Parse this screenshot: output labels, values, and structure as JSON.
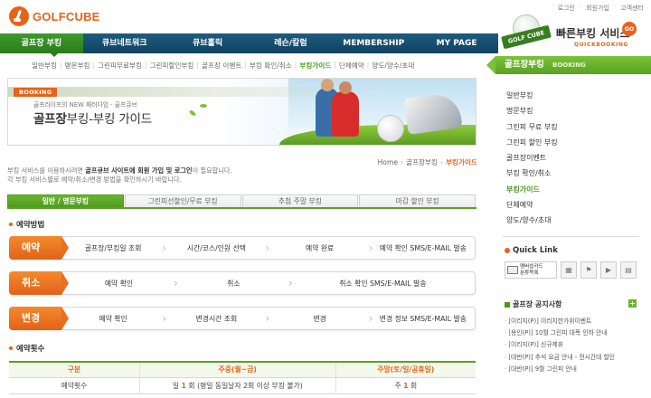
{
  "logo": {
    "text": "GOLFCUBE"
  },
  "util_links": [
    "로그인",
    "회원가입",
    "고객센터"
  ],
  "gnb": [
    {
      "label": "골프장 부킹",
      "active": true
    },
    {
      "label": "큐브네트워크",
      "active": false
    },
    {
      "label": "큐브홀릭",
      "active": false
    },
    {
      "label": "레슨/칼럼",
      "active": false
    },
    {
      "label": "MEMBERSHIP",
      "active": false
    },
    {
      "label": "MY PAGE",
      "active": false
    }
  ],
  "snb": [
    {
      "label": "일반부킹",
      "active": false
    },
    {
      "label": "명문부킹",
      "active": false
    },
    {
      "label": "그린피무료부킹",
      "active": false
    },
    {
      "label": "그린피할인부킹",
      "active": false
    },
    {
      "label": "골프장 이벤트",
      "active": false
    },
    {
      "label": "부킹 확인/취소",
      "active": false
    },
    {
      "label": "부킹가이드",
      "active": true
    },
    {
      "label": "단체예약",
      "active": false
    },
    {
      "label": "양도/양수/초대",
      "active": false
    }
  ],
  "booking_badge": {
    "tag": "GOLF CUBE",
    "title": "빠른부킹 서비스",
    "go": "GO",
    "sub": "QUICKBOOKING"
  },
  "banner": {
    "badge": "BOOKING",
    "small": "골프라이프의 NEW 패러다임 - 골프큐브",
    "title_bold": "골프장",
    "title_rest": "부킹-부킹 가이드"
  },
  "breadcrumb": {
    "home": "Home",
    "mid": "골프장부킹",
    "current": "부킹가이드"
  },
  "intro": {
    "line1_a": "부킹 서비스를 이용하시려면 ",
    "line1_b": "골프큐브 사이트에 회원 가입 및 로그인",
    "line1_c": "이 필요합니다.",
    "line2": "각 부킹 서비스별로 예약/취소/변경 방법을 확인하시기 바랍니다."
  },
  "tabs": [
    {
      "label": "일반 / 명문부킹",
      "active": true
    },
    {
      "label": "그린피선할인/무료 부킹",
      "active": false
    },
    {
      "label": "추첨 주말 부킹",
      "active": false
    },
    {
      "label": "마감 할인 부킹",
      "active": false
    }
  ],
  "section_method": "예약방법",
  "flows": [
    {
      "label": "예약",
      "steps": [
        "골프장/부킹일 조회",
        "시간/코스/인원 선택",
        "예약 완료",
        "예약 확인 SMS/E-MAIL 발송"
      ]
    },
    {
      "label": "취소",
      "steps": [
        "예약 확인",
        "취소",
        "취소 확인 SMS/E-MAIL 발송"
      ]
    },
    {
      "label": "변경",
      "steps": [
        "예약 확인",
        "변경시간 조회",
        "변경",
        "변경 정보 SMS/E-MAIL 발송"
      ]
    }
  ],
  "section_count": "예약횟수",
  "count_table": {
    "headers": [
      "구분",
      "주중(월~금)",
      "주말(토/일/공휴일)"
    ],
    "row": {
      "label": "예약횟수",
      "weekday_pre": "일 ",
      "weekday_num": "1",
      "weekday_post": " 회 (평일 동일날자 2회 이상 부킹 불가)",
      "weekend_pre": "주 ",
      "weekend_num": "1",
      "weekend_post": " 회"
    }
  },
  "lnb": {
    "head": "골프장부킹",
    "head_en": "BOOKING",
    "items": [
      {
        "label": "일반부킹",
        "active": false
      },
      {
        "label": "명문부킹",
        "active": false
      },
      {
        "label": "그린피 무료 부킹",
        "active": false
      },
      {
        "label": "그린피 할인 부킹",
        "active": false
      },
      {
        "label": "골프장이벤트",
        "active": false
      },
      {
        "label": "부킹 확인/취소",
        "active": false
      },
      {
        "label": "부킹가이드",
        "active": true
      },
      {
        "label": "단체예약",
        "active": false
      },
      {
        "label": "양도/양수/초대",
        "active": false
      }
    ]
  },
  "quick_link": {
    "title": "Quick Link",
    "card_line1": "멤버쉽카드",
    "card_line2": "분류목록"
  },
  "notice": {
    "title": "골프장 공지사항",
    "items": [
      "[이리지(P)] 이리지한가위이벤트",
      "[용인(P)] 10월 그린피 대폭 인하 안내",
      "[이리지(P)] 신규제휴",
      "[대반(P)] 추석 요금 안내 - 전시간대 할인",
      "[대반(P)] 9월 그린피 안내"
    ]
  }
}
